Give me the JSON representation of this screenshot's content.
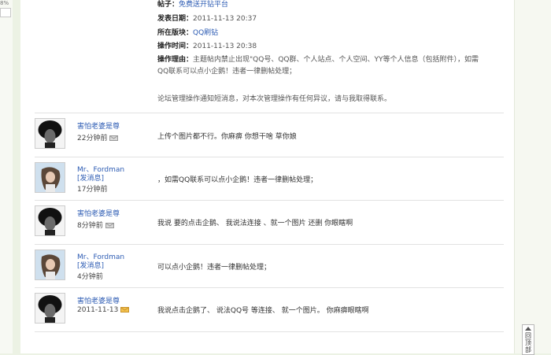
{
  "left_strip": {
    "percent": "8%"
  },
  "notice": {
    "post_label": "帖子：",
    "post_value": "免费送开钻平台",
    "date_label": "发表日期：",
    "date_value": "2011-11-13 20:37",
    "board_label": "所在版块：",
    "board_value": "QQ刷钻",
    "optime_label": "操作时间：",
    "optime_value": "2011-11-13 20:38",
    "reason_label": "操作理由：",
    "reason_line1": "主题帖内禁止出现\"QQ号、QQ群、个人站点、个人空间、YY等个人信息（包括附件），如需",
    "reason_line2": "QQ联系可以点小企鹅！违者一律删帖处理；",
    "footer": "论坛管理操作通知短消息，对本次管理操作有任何异议，请与我取得联系。"
  },
  "replies": [
    {
      "user": "害怕老婆是尊",
      "send_msg": "",
      "time": "22分钟前",
      "envelope": "gray",
      "avatar": "dark-portrait",
      "message": "上传个图片都不行。你麻痹  你想干啥  草你娘"
    },
    {
      "user": "Mr、Fordman",
      "send_msg": "[发消息]",
      "time": "17分钟前",
      "envelope": "",
      "avatar": "girl-portrait",
      "message": "，如需QQ联系可以点小企鹅！违者一律删帖处理；"
    },
    {
      "user": "害怕老婆是尊",
      "send_msg": "",
      "time": "8分钟前",
      "envelope": "gray",
      "avatar": "dark-portrait",
      "message": "我说  要的点击企鹅、  我说法连接  、就一个图片  还删  你眼瞎啊"
    },
    {
      "user": "Mr、Fordman",
      "send_msg": "[发消息]",
      "time": "4分钟前",
      "envelope": "",
      "avatar": "girl-portrait",
      "message": "可以点小企鹅！违者一律删帖处理；"
    },
    {
      "user": "害怕老婆是尊",
      "send_msg": "",
      "time": "2011-11-13",
      "envelope": "yellow",
      "avatar": "dark-portrait",
      "message": "我说点击企鹅了、  说法QQ号  等连接、   就一个图片。   你麻痹眼瞎啊"
    }
  ],
  "back_to_top": "回顶部",
  "colors": {
    "link": "#2c5bb3",
    "page_bg": "#ecf2e4",
    "envelope_gray": "#d8d8d8",
    "envelope_yellow": "#f3c14e"
  }
}
